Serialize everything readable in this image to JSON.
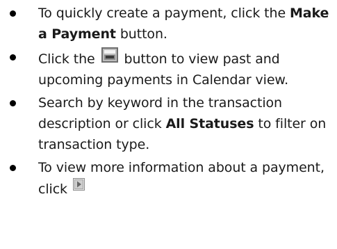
{
  "bullets": [
    {
      "pre": "To quickly create a payment, click the ",
      "bold": "Make a Payment",
      "post": " button."
    },
    {
      "pre": "Click the ",
      "icon": "calendar-view-icon",
      "post": " button to view past and upcoming payments in Calendar view."
    },
    {
      "pre": "Search by keyword in the transaction description or click ",
      "bold": "All Statuses",
      "post": " to filter on transaction type."
    },
    {
      "pre": "To view more information about a payment, click ",
      "icon": "expand-arrow-icon"
    }
  ],
  "colors": {
    "text": "#1a1a1a",
    "icon_frame": "#7a7a7a",
    "icon_fill": "#d9d9d9"
  }
}
